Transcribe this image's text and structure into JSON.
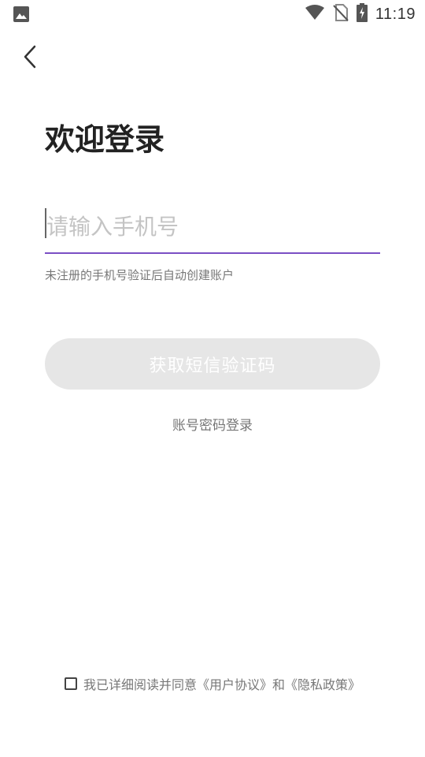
{
  "status_bar": {
    "time": "11:19",
    "icons": [
      "image-icon",
      "wifi-icon",
      "no-sim-icon",
      "battery-charging-icon"
    ]
  },
  "nav": {
    "back_icon": "chevron-left-icon"
  },
  "title": "欢迎登录",
  "phone_input": {
    "placeholder": "请输入手机号",
    "value": ""
  },
  "hint": "未注册的手机号验证后自动创建账户",
  "sms_button_label": "获取短信验证码",
  "password_login_label": "账号密码登录",
  "agreement": {
    "checked": false,
    "prefix": "我已详细阅读并同意",
    "user_agreement": "《用户协议》",
    "conjunction": "和",
    "privacy_policy": "《隐私政策》"
  },
  "colors": {
    "accent": "#7b4fc4",
    "button_disabled_bg": "#e6e6e6",
    "hint_text": "#777777"
  }
}
